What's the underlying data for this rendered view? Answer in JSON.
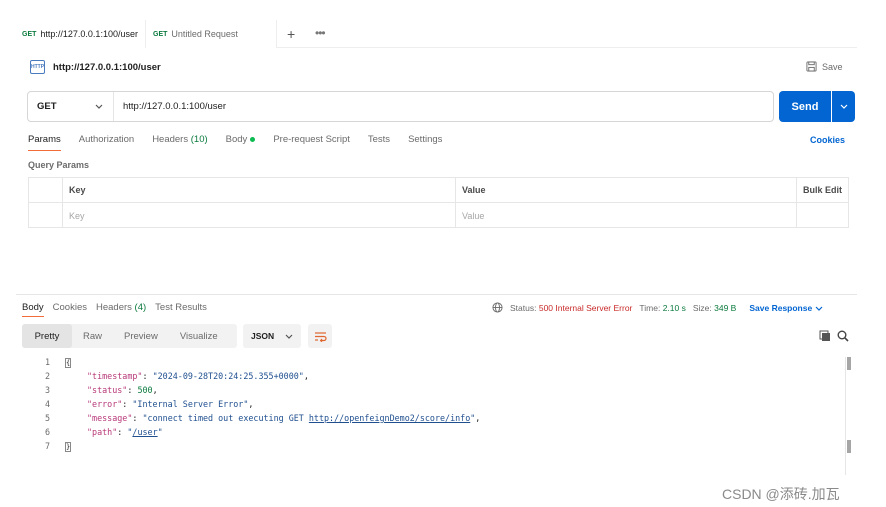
{
  "tabs": [
    {
      "method": "GET",
      "label": "http://127.0.0.1:100/user"
    },
    {
      "method": "GET",
      "label": "Untitled Request"
    }
  ],
  "icons": {
    "plus": "plus-icon",
    "more": "more-icon"
  },
  "request": {
    "badge": "HTTP",
    "title": "http://127.0.0.1:100/user",
    "save_label": "Save",
    "method": "GET",
    "url": "http://127.0.0.1:100/user",
    "send_label": "Send"
  },
  "request_tabs": {
    "params": "Params",
    "authorization": "Authorization",
    "headers": "Headers",
    "headers_count": "(10)",
    "body": "Body",
    "pre_request": "Pre-request Script",
    "tests": "Tests",
    "settings": "Settings",
    "cookies": "Cookies"
  },
  "query_params": {
    "title": "Query Params",
    "col_key": "Key",
    "col_value": "Value",
    "bulk_edit": "Bulk Edit",
    "key_placeholder": "Key",
    "value_placeholder": "Value"
  },
  "response_tabs": {
    "body": "Body",
    "cookies": "Cookies",
    "headers": "Headers",
    "headers_count": "(4)",
    "test_results": "Test Results"
  },
  "status": {
    "status_label": "Status:",
    "status_value": "500 Internal Server Error",
    "time_label": "Time:",
    "time_value": "2.10 s",
    "size_label": "Size:",
    "size_value": "349 B",
    "save_response": "Save Response"
  },
  "format": {
    "pretty": "Pretty",
    "raw": "Raw",
    "preview": "Preview",
    "visualize": "Visualize",
    "json": "JSON"
  },
  "code": {
    "line_numbers": [
      "1",
      "2",
      "3",
      "4",
      "5",
      "6",
      "7"
    ],
    "open_brace": "{",
    "close_brace": "}",
    "timestamp_key": "\"timestamp\"",
    "timestamp_val": "\"2024-09-28T20:24:25.355+0000\"",
    "status_key": "\"status\"",
    "status_val": "500",
    "error_key": "\"error\"",
    "error_val": "\"Internal Server Error\"",
    "message_key": "\"message\"",
    "message_prefix": "\"connect timed out executing GET ",
    "message_link": "http://openfeignDemo2/score/info",
    "message_suffix": "\"",
    "path_key": "\"path\"",
    "path_q1": "\"",
    "path_link": "/user",
    "path_q2": "\""
  },
  "watermark": "CSDN @添砖.加瓦"
}
